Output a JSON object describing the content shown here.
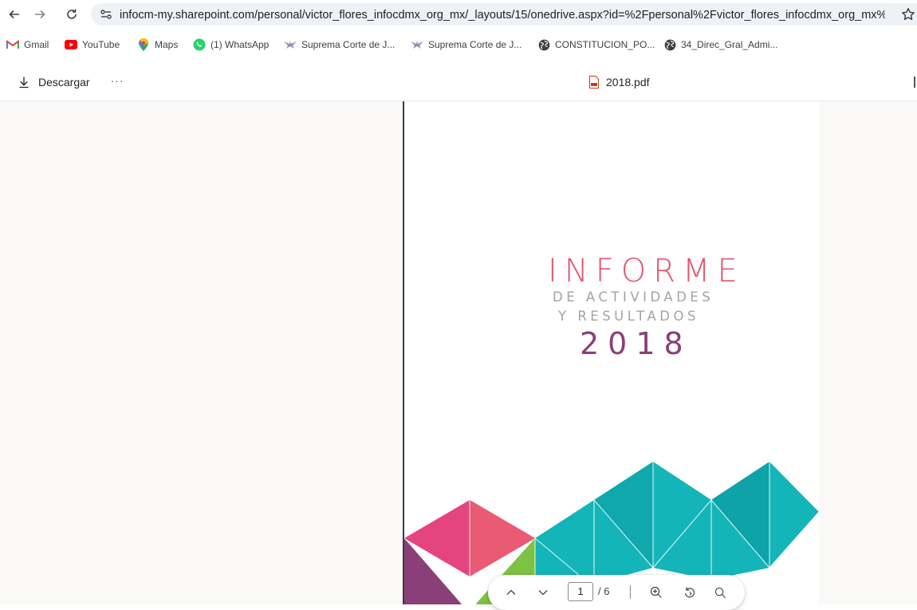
{
  "browser": {
    "url": "infocm-my.sharepoint.com/personal/victor_flores_infocdmx_org_mx/_layouts/15/onedrive.aspx?id=%2Fpersonal%2Fvictor_flores_infocdmx_org_mx%2FDo...",
    "nav_icons": [
      "back-arrow-icon",
      "forward-arrow-icon",
      "reload-icon",
      "site-info-icon",
      "bookmark-star-icon"
    ]
  },
  "bookmarks": [
    {
      "label": "Gmail",
      "icon": "gmail-icon"
    },
    {
      "label": "YouTube",
      "icon": "youtube-icon"
    },
    {
      "label": "Maps",
      "icon": "maps-icon"
    },
    {
      "label": "(1) WhatsApp",
      "icon": "whatsapp-icon"
    },
    {
      "label": "Suprema Corte de J...",
      "icon": "eagle-icon"
    },
    {
      "label": "Suprema Corte de J...",
      "icon": "eagle-icon"
    },
    {
      "label": "CONSTITUCION_PO...",
      "icon": "globe-icon"
    },
    {
      "label": "34_Direc_Gral_Admi...",
      "icon": "globe-icon"
    }
  ],
  "toolbar": {
    "download_label": "Descargar",
    "more_label": "···",
    "file_name": "2018.pdf"
  },
  "document": {
    "title_line1": "INFORME",
    "title_line2": "DE ACTIVIDADES",
    "title_line3": "Y RESULTADOS",
    "title_year": "2018",
    "colors": {
      "pink": "#e2566e",
      "magenta": "#e5457f",
      "purple": "#8b3f78",
      "green": "#7dc242",
      "teal": "#13b5b9"
    }
  },
  "pager": {
    "current_page": "1",
    "total_label": "/ 6",
    "icons": [
      "chevron-up-icon",
      "chevron-down-icon",
      "zoom-in-icon",
      "rotate-icon",
      "search-icon"
    ]
  }
}
